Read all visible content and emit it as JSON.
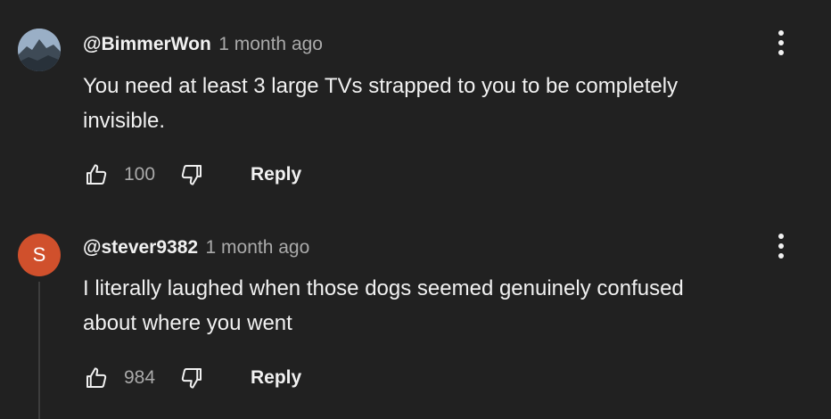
{
  "comments": [
    {
      "author": "@BimmerWon",
      "time": "1 month ago",
      "text_line1": "You need at least 3 large TVs strapped to you to be completely",
      "text_line2": "invisible.",
      "likes": "100",
      "reply_label": "Reply",
      "avatar": "landscape-photo"
    },
    {
      "author": "@stever9382",
      "time": "1 month ago",
      "text_line1": "I literally laughed when those dogs seemed genuinely confused",
      "text_line2": "about where you went",
      "likes": "984",
      "reply_label": "Reply",
      "avatar_letter": "S",
      "avatar_color": "#d0502c"
    }
  ],
  "icons": {
    "like": "thumbs-up-icon",
    "dislike": "thumbs-down-icon",
    "more": "more-vertical-icon"
  },
  "colors": {
    "background": "#212121",
    "primary_text": "#f1f1f1",
    "secondary_text": "#aaaaaa"
  }
}
